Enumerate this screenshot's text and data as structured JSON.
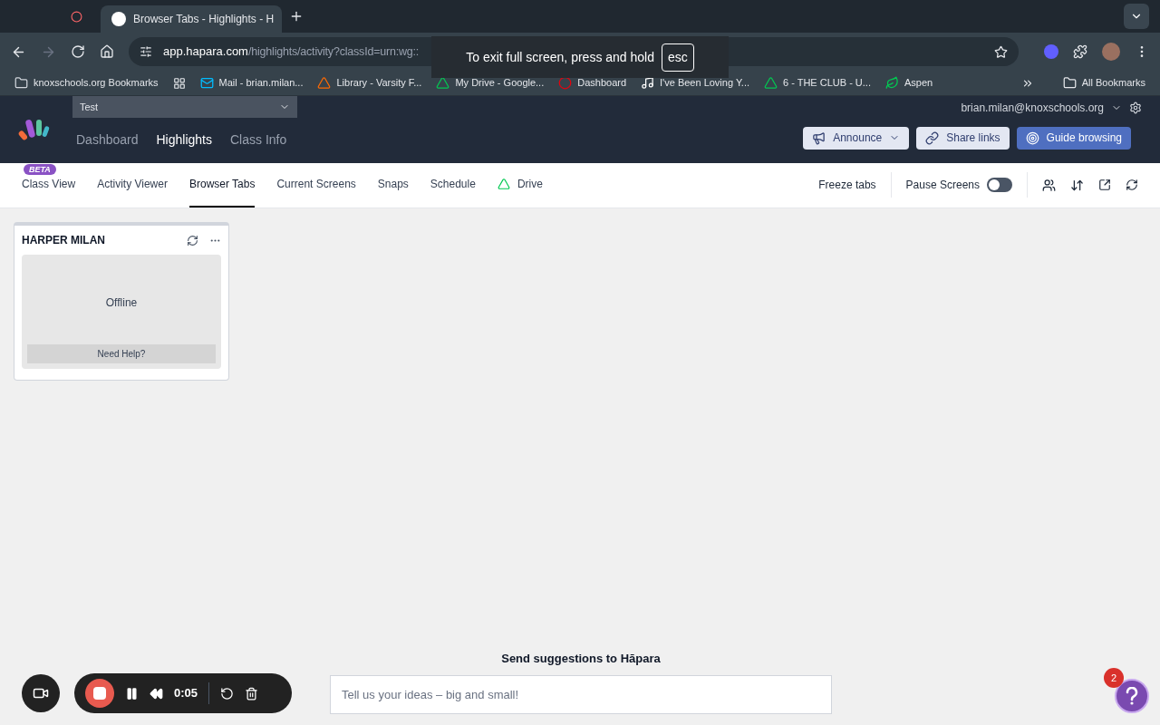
{
  "browser": {
    "tabs": [
      {
        "title": "Browser Tabs - Highlights - H",
        "selected": true
      }
    ],
    "url_host": "app.hapara.com",
    "url_path": "/highlights/activity?classId=urn:wg::",
    "fullscreen_notice": {
      "text": "To exit full screen, press and hold",
      "key": "esc"
    },
    "bookmarks": [
      {
        "label": "knoxschools.org Bookmarks",
        "kind": "folder"
      },
      {
        "label": "Mail - brian.milan...",
        "kind": "mail"
      },
      {
        "label": "Library - Varsity F...",
        "kind": "library"
      },
      {
        "label": "My Drive - Google...",
        "kind": "drive"
      },
      {
        "label": "Dashboard",
        "kind": "dashboard"
      },
      {
        "label": "I've Been Loving Y...",
        "kind": "music"
      },
      {
        "label": "6 - THE CLUB - U...",
        "kind": "drive"
      },
      {
        "label": "Aspen",
        "kind": "aspen"
      }
    ],
    "all_bookmarks": "All Bookmarks"
  },
  "app": {
    "class_select": "Test",
    "nav": [
      {
        "label": "Dashboard",
        "selected": false
      },
      {
        "label": "Highlights",
        "selected": true
      },
      {
        "label": "Class Info",
        "selected": false
      }
    ],
    "user_email": "brian.milan@knoxschools.org",
    "actions": [
      {
        "label": "Announce",
        "kind": "announce"
      },
      {
        "label": "Share links",
        "kind": "share"
      },
      {
        "label": "Guide browsing",
        "kind": "guide"
      }
    ],
    "subtabs": [
      {
        "label": "Class View",
        "selected": false,
        "badge": "BETA"
      },
      {
        "label": "Activity Viewer",
        "selected": false
      },
      {
        "label": "Browser Tabs",
        "selected": true
      },
      {
        "label": "Current Screens",
        "selected": false
      },
      {
        "label": "Snaps",
        "selected": false
      },
      {
        "label": "Schedule",
        "selected": false
      },
      {
        "label": "Drive",
        "selected": false,
        "drive": true
      }
    ],
    "freeze_tabs": "Freeze tabs",
    "pause_screens": {
      "label": "Pause Screens",
      "on": false
    },
    "students": [
      {
        "name": "HARPER MILAN",
        "status": "Offline",
        "help": "Need Help?"
      }
    ],
    "suggestions": {
      "title": "Send suggestions to Hāpara",
      "placeholder": "Tell us your ideas – big and small!"
    },
    "recorder": {
      "time": "0:05"
    },
    "help_badge": "2"
  }
}
